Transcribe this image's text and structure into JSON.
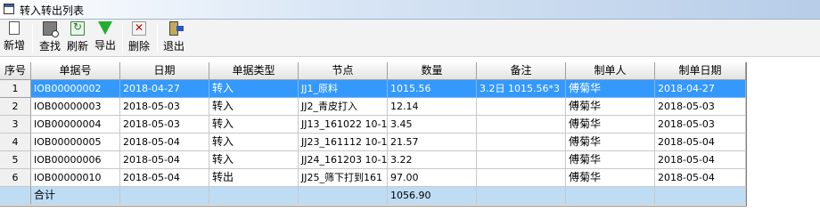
{
  "window": {
    "title": "转入转出列表"
  },
  "toolbar": {
    "new_label": "新增",
    "find_label": "查找",
    "refresh_label": "刷新",
    "export_label": "导出",
    "delete_label": "删除",
    "exit_label": "退出"
  },
  "table": {
    "headers": [
      "序号",
      "单据号",
      "日期",
      "单据类型",
      "节点",
      "数量",
      "备注",
      "制单人",
      "制单日期"
    ],
    "rows": [
      [
        "1",
        "IOB00000002",
        "2018-04-27",
        "转入",
        "JJ1_原料",
        "1015.56",
        "3.2日 1015.56*3",
        "傅菊华",
        "2018-04-27"
      ],
      [
        "2",
        "IOB00000003",
        "2018-05-03",
        "转入",
        "JJ2_青皮打入",
        "12.14",
        "",
        "傅菊华",
        "2018-05-03"
      ],
      [
        "3",
        "IOB00000004",
        "2018-05-03",
        "转入",
        "JJ13_161022 10-1",
        "3.45",
        "",
        "傅菊华",
        "2018-05-03"
      ],
      [
        "4",
        "IOB00000005",
        "2018-05-04",
        "转入",
        "JJ23_161112 10-1",
        "21.57",
        "",
        "傅菊华",
        "2018-05-04"
      ],
      [
        "5",
        "IOB00000006",
        "2018-05-04",
        "转入",
        "JJ24_161203 10-1",
        "3.22",
        "",
        "傅菊华",
        "2018-05-04"
      ],
      [
        "6",
        "IOB00000010",
        "2018-05-04",
        "转出",
        "JJ25_筛下打到161",
        "97.00",
        "",
        "傅菊华",
        "2018-05-04"
      ]
    ],
    "total_label": "合计",
    "total_quantity": "1056.90"
  }
}
